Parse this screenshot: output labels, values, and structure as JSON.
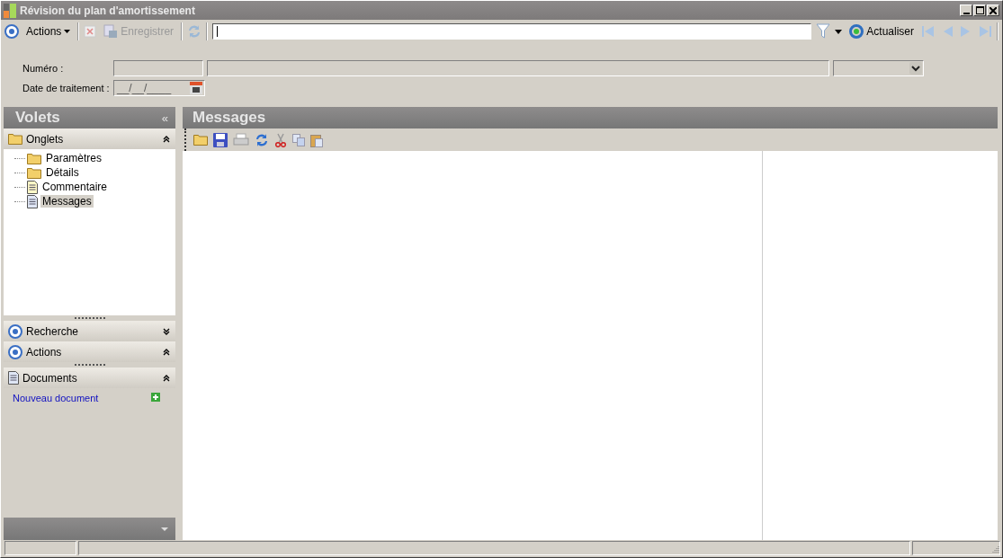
{
  "window": {
    "title": "Révision du plan d'amortissement"
  },
  "toolbar": {
    "actions_label": "Actions",
    "save_label": "Enregistrer",
    "refresh_label": "Actualiser"
  },
  "form": {
    "fields": [
      {
        "label": "Numéro :",
        "kind": "number"
      },
      {
        "label": "Date de traitement :",
        "kind": "date",
        "value": "__/__/____"
      }
    ]
  },
  "sidebar": {
    "title": "Volets",
    "collapse_glyph": "«",
    "sections": [
      {
        "title": "Onglets",
        "kind": "tree",
        "expanded": true,
        "items": [
          {
            "label": "Paramètres",
            "kind": "folder",
            "selected": false
          },
          {
            "label": "Détails",
            "kind": "folder",
            "selected": false
          },
          {
            "label": "Commentaire",
            "kind": "note",
            "selected": false
          },
          {
            "label": "Messages",
            "kind": "doc",
            "selected": true
          }
        ]
      },
      {
        "title": "Recherche",
        "kind": "panel",
        "expanded": false
      },
      {
        "title": "Actions",
        "kind": "panel",
        "expanded": true
      },
      {
        "title": "Documents",
        "kind": "docs",
        "expanded": true,
        "links": [
          "Nouveau document"
        ]
      }
    ]
  },
  "main": {
    "title": "Messages"
  }
}
